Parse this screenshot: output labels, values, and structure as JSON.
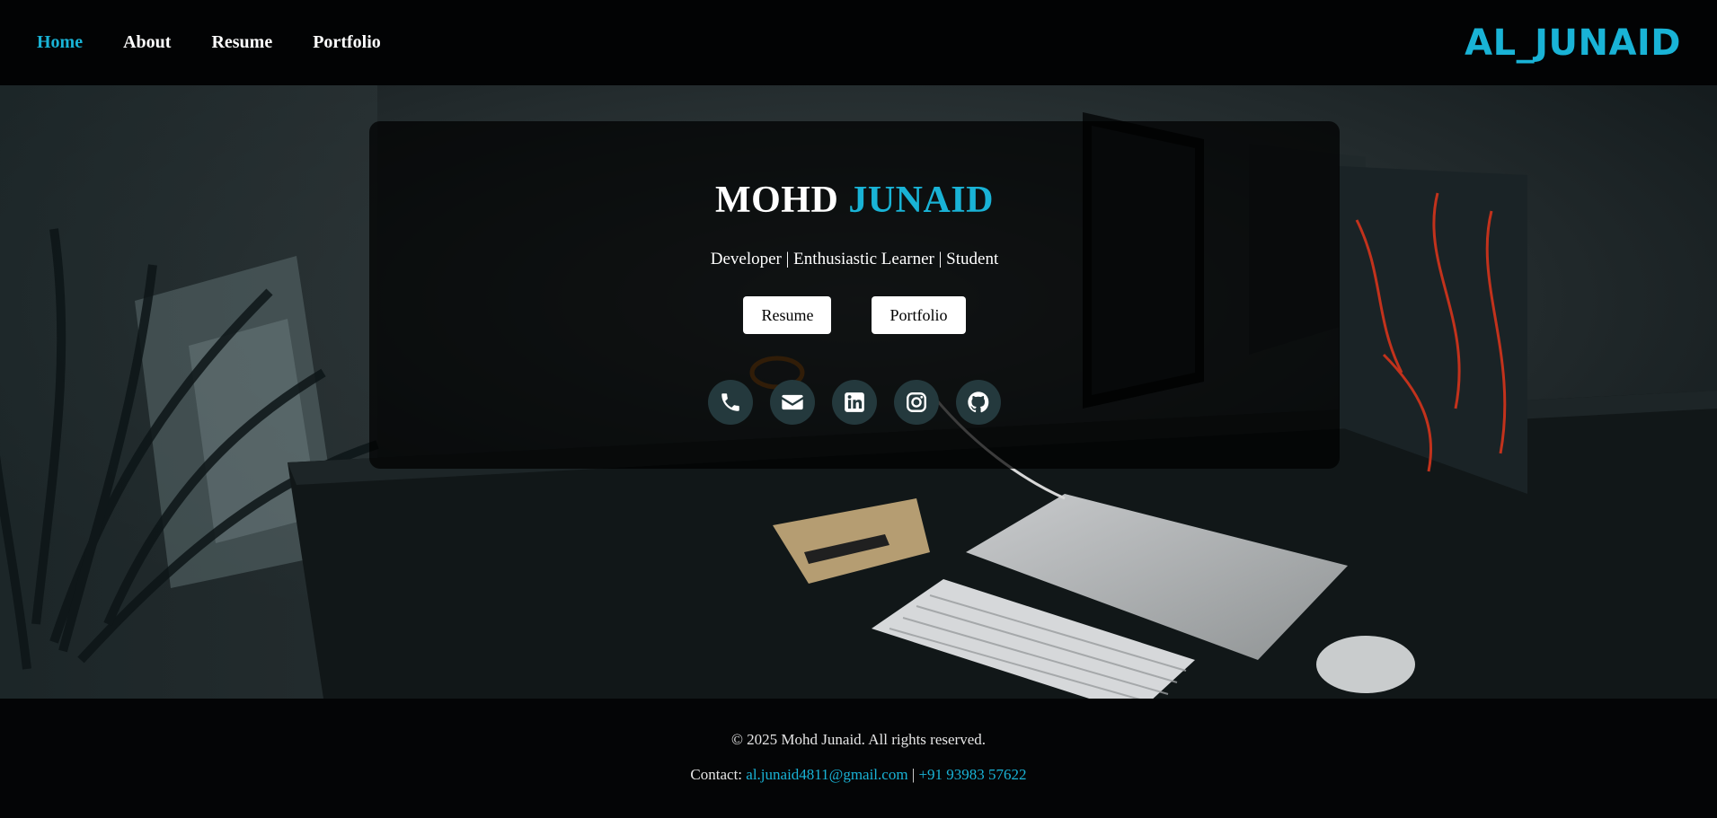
{
  "nav": {
    "links": [
      {
        "label": "Home",
        "active": true
      },
      {
        "label": "About",
        "active": false
      },
      {
        "label": "Resume",
        "active": false
      },
      {
        "label": "Portfolio",
        "active": false
      }
    ],
    "brand": "AL_JUNAID"
  },
  "hero": {
    "name_first": "MOHD",
    "name_last": "JUNAID",
    "tagline": "Developer | Enthusiastic Learner | Student",
    "buttons": {
      "resume": "Resume",
      "portfolio": "Portfolio"
    },
    "social_icons": [
      "phone-icon",
      "envelope-icon",
      "linkedin-icon",
      "instagram-icon",
      "github-icon"
    ]
  },
  "footer": {
    "copyright": "© 2025 Mohd Junaid. All rights reserved.",
    "contact_label": "Contact:",
    "email": "al.junaid4811@gmail.com",
    "separator": "|",
    "phone": "+91 93983 57622"
  },
  "colors": {
    "accent": "#19b3d6",
    "navbar_bg": "#020304",
    "card_bg": "rgba(0,0,0,0.72)",
    "social_bg": "#24393d"
  }
}
